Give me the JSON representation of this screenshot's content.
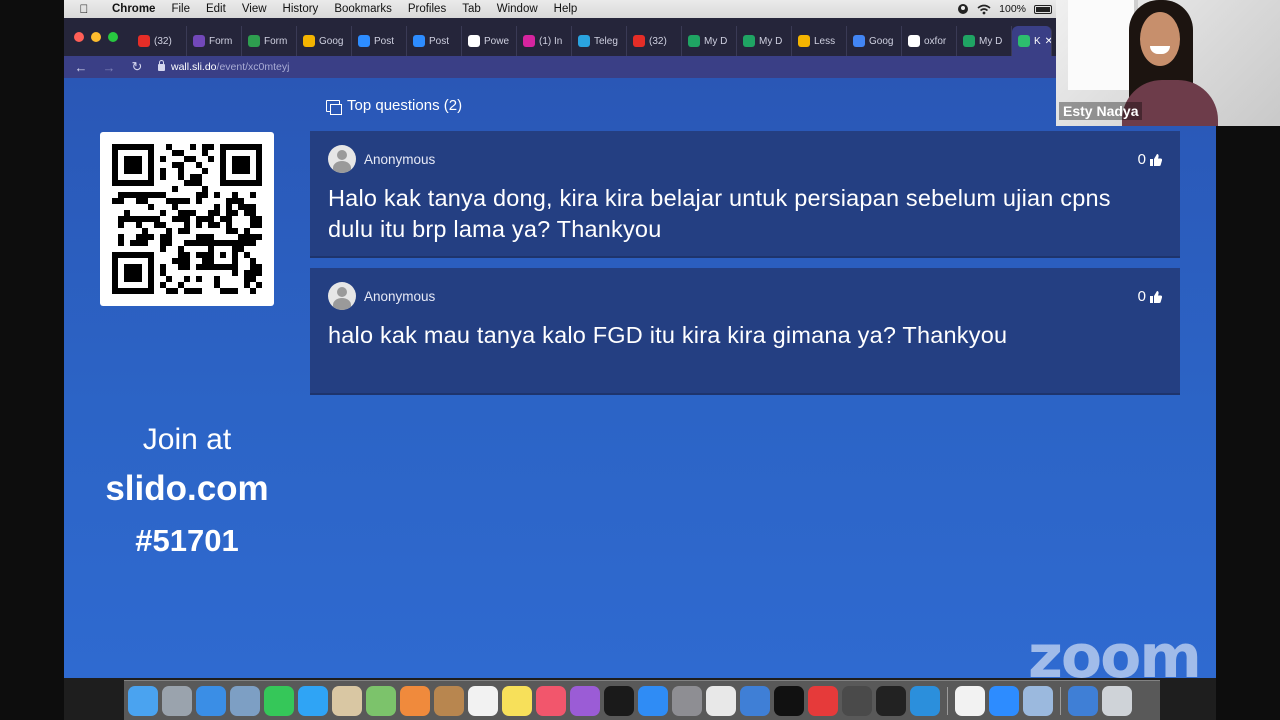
{
  "menubar": {
    "app_name": "Chrome",
    "items": [
      "File",
      "Edit",
      "View",
      "History",
      "Bookmarks",
      "Profiles",
      "Tab",
      "Window",
      "Help"
    ],
    "battery": "100%"
  },
  "tabs": [
    {
      "label": "(32)",
      "color": "#e52d27"
    },
    {
      "label": "Form",
      "color": "#7248b9"
    },
    {
      "label": "Form",
      "color": "#2e9e4f"
    },
    {
      "label": "Goog",
      "color": "#f4b400"
    },
    {
      "label": "Post",
      "color": "#2d8cff"
    },
    {
      "label": "Post",
      "color": "#2d8cff"
    },
    {
      "label": "Powe",
      "color": "#ffffff"
    },
    {
      "label": "(1) In",
      "color": "#d6249f"
    },
    {
      "label": "Teleg",
      "color": "#2aa3df"
    },
    {
      "label": "(32)",
      "color": "#e52d27"
    },
    {
      "label": "My D",
      "color": "#1fa463"
    },
    {
      "label": "My D",
      "color": "#1fa463"
    },
    {
      "label": "Less",
      "color": "#f4b400"
    },
    {
      "label": "Goog",
      "color": "#4285f4"
    },
    {
      "label": "oxfor",
      "color": "#ffffff"
    },
    {
      "label": "My D",
      "color": "#1fa463"
    },
    {
      "label": "K",
      "color": "#2dbd6e",
      "active": true
    }
  ],
  "address": {
    "host": "wall.sli.do",
    "path": "/event/xc0mteyj"
  },
  "wall": {
    "header_label": "Top questions (2)",
    "join": {
      "line1": "Join at",
      "line2": "slido.com",
      "line3": "#51701"
    },
    "questions": [
      {
        "author": "Anonymous",
        "likes": "0",
        "text": "Halo kak tanya dong, kira kira belajar untuk persiapan sebelum ujian cpns dulu itu brp lama ya? Thankyou"
      },
      {
        "author": "Anonymous",
        "likes": "0",
        "text": "halo kak mau tanya kalo FGD itu kira kira gimana ya? Thankyou"
      }
    ]
  },
  "zoom": {
    "participant_name": "Esty Nadya",
    "watermark": "zoom"
  },
  "dock": {
    "icons": [
      {
        "name": "finder-icon",
        "color": "#4aa3f0"
      },
      {
        "name": "launchpad-icon",
        "color": "#9aa3ad"
      },
      {
        "name": "safari-icon",
        "color": "#3a8ee6"
      },
      {
        "name": "preview-icon",
        "color": "#7d9fc4"
      },
      {
        "name": "facetime-icon",
        "color": "#35c759"
      },
      {
        "name": "messages-icon",
        "color": "#2fa4f5"
      },
      {
        "name": "contacts-icon",
        "color": "#d9c7a3"
      },
      {
        "name": "maps-icon",
        "color": "#7cc36b"
      },
      {
        "name": "photos-icon",
        "color": "#f08a3c"
      },
      {
        "name": "notes-brown-icon",
        "color": "#b8864f"
      },
      {
        "name": "calendar-icon",
        "color": "#f2f2f2"
      },
      {
        "name": "stickies-icon",
        "color": "#f7e05a"
      },
      {
        "name": "music-icon",
        "color": "#f2566c"
      },
      {
        "name": "podcasts-icon",
        "color": "#9b5cd6"
      },
      {
        "name": "tv-icon",
        "color": "#1a1a1a"
      },
      {
        "name": "app-store-icon",
        "color": "#2f8cf5"
      },
      {
        "name": "system-preferences-icon",
        "color": "#8e8e93"
      },
      {
        "name": "chrome-icon",
        "color": "#e8e8e8"
      },
      {
        "name": "whatsapp-folder-icon",
        "color": "#3f7fd6"
      },
      {
        "name": "intellij-icon",
        "color": "#111111"
      },
      {
        "name": "oo-app-icon",
        "color": "#e63a3a"
      },
      {
        "name": "sublime-icon",
        "color": "#4a4a4a"
      },
      {
        "name": "terminal-icon",
        "color": "#222222"
      },
      {
        "name": "vscode-icon",
        "color": "#2b8fdc"
      },
      {
        "name": "oo-app-icon-2",
        "color": "#f2f2f2"
      },
      {
        "name": "zoom-icon",
        "color": "#2d8cff"
      },
      {
        "name": "screenshot-icon",
        "color": "#9bb9de"
      },
      {
        "name": "downloads-folder-icon",
        "color": "#3f7fd6"
      },
      {
        "name": "trash-icon",
        "color": "#cfd3d8"
      }
    ]
  }
}
